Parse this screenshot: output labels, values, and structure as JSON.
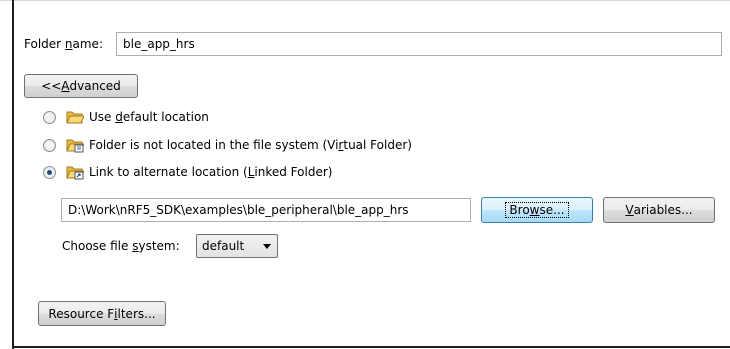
{
  "folder_name": {
    "label": "Folder name:",
    "label_pre": "Folder ",
    "label_accel": "n",
    "label_post": "ame:",
    "value": "ble_app_hrs"
  },
  "advanced_button": {
    "pre": "<< ",
    "accel": "A",
    "post": "dvanced"
  },
  "location_options": [
    {
      "pre": "Use ",
      "accel": "d",
      "post": "efault location",
      "checked": false
    },
    {
      "pre": "Folder is not located in the file system (Vi",
      "accel": "r",
      "post": "tual Folder)",
      "checked": false
    },
    {
      "pre": "Link to alternate location (",
      "accel": "L",
      "post": "inked Folder)",
      "checked": true
    }
  ],
  "linked_path": {
    "value": "D:\\Work\\nRF5_SDK\\examples\\ble_peripheral\\ble_app_hrs"
  },
  "browse_button": {
    "pre": "Bro",
    "accel": "w",
    "post": "se..."
  },
  "variables_button": {
    "pre": "",
    "accel": "V",
    "post": "ariables..."
  },
  "file_system": {
    "pre": "Choose file ",
    "accel": "s",
    "post": "ystem:",
    "selected": "default"
  },
  "resource_filters_button": {
    "pre": "Resource F",
    "accel": "i",
    "post": "lters..."
  }
}
